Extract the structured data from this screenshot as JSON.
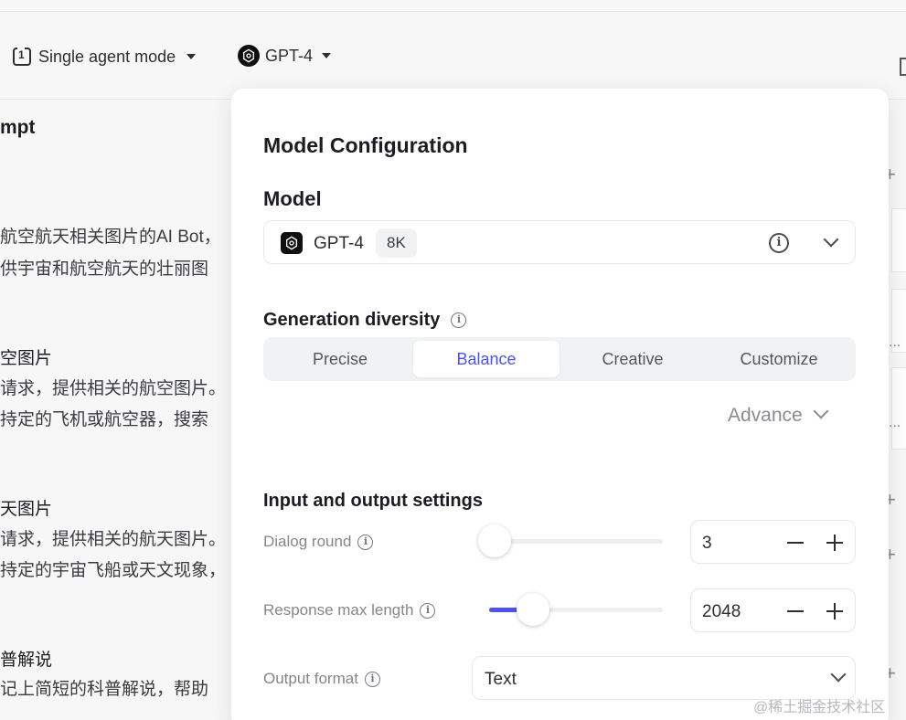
{
  "header": {
    "mode_label": "Single agent mode",
    "model_label": "GPT-4"
  },
  "left_panel": {
    "title": "mpt",
    "lines": [
      "航空航天相关图片的AI Bot，",
      "供宇宙和航空航天的壮丽图",
      "空图片",
      "请求，提供相关的航空图片。",
      "持定的飞机或航空器，搜索",
      "天图片",
      "请求，提供相关的航天图片。",
      "持定的宇宙飞船或天文现象，",
      "普解说",
      "记上简短的科普解说，帮助"
    ]
  },
  "right_column": {
    "ellipsis": "..."
  },
  "watermark": "@稀土掘金技术社区",
  "modal": {
    "title": "Model Configuration",
    "model_section_label": "Model",
    "model_name": "GPT-4",
    "context_badge": "8K",
    "diversity_label": "Generation diversity",
    "diversity_options": [
      "Precise",
      "Balance",
      "Creative",
      "Customize"
    ],
    "diversity_selected": "Balance",
    "advance_label": "Advance",
    "io_section_label": "Input and output settings",
    "dialog_round": {
      "label": "Dialog round",
      "value": "3",
      "slider_fraction": 0.03
    },
    "response_max_length": {
      "label": "Response max length",
      "value": "2048",
      "slider_fraction": 0.25
    },
    "output_format": {
      "label": "Output format",
      "value": "Text"
    }
  },
  "colors": {
    "accent": "#4d53e8",
    "background": "#f7f7f8"
  }
}
